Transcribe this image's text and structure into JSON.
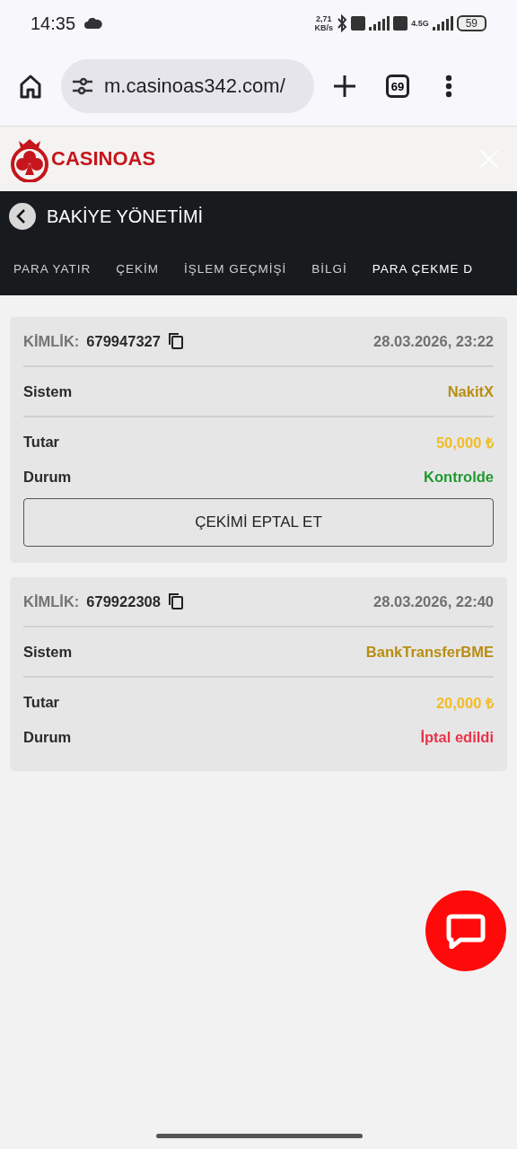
{
  "status_bar": {
    "time": "14:35",
    "speed": "2,71",
    "speed_unit": "KB/s",
    "network": "4.5G",
    "battery": "59"
  },
  "browser": {
    "url": "m.casinoas342.com/",
    "tab_count": "69"
  },
  "site": {
    "logo": "CASINOAS"
  },
  "header": {
    "title": "BAKİYE YÖNETİMİ"
  },
  "tabs": [
    {
      "label": "PARA YATIR",
      "selected": false
    },
    {
      "label": "ÇEKİM",
      "selected": false
    },
    {
      "label": "İŞLEM GEÇMİŞİ",
      "selected": false
    },
    {
      "label": "BİLGİ",
      "selected": false
    },
    {
      "label": "PARA ÇEKME D",
      "selected": true
    }
  ],
  "withdrawals": [
    {
      "id_label": "KİMLİK:",
      "id": "679947327",
      "date": "28.03.2026, 23:22",
      "system_label": "Sistem",
      "system": "NakitX",
      "amount_label": "Tutar",
      "amount": "50,000 ₺",
      "status_label": "Durum",
      "status": "Kontrolde",
      "color": "#1f9a2e",
      "cancel_button": "ÇEKİMİ EPTAL ET"
    },
    {
      "id_label": "KİMLİK:",
      "id": "679922308",
      "date": "28.03.2026, 22:40",
      "system_label": "Sistem",
      "system": "BankTransferBME",
      "amount_label": "Tutar",
      "amount": "20,000 ₺",
      "status_label": "Durum",
      "status": "İptal edildi",
      "color": "#e8334a"
    }
  ]
}
